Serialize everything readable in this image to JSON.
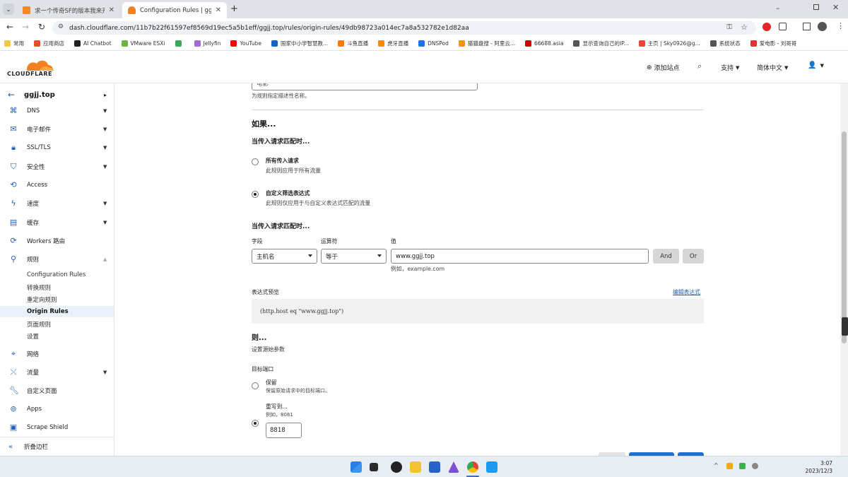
{
  "browser": {
    "tabs": [
      {
        "title": "求一个传奇SF的版本我来开服...",
        "active": false
      },
      {
        "title": "Configuration Rules | ggjj.top",
        "active": true
      }
    ],
    "new_tab": "+",
    "url": "dash.cloudflare.com/11b7b22f61597ef8569d19ec5a5b1eff/ggjj.top/rules/origin-rules/49db98723a014ec7a8a532782e1d82aa",
    "bookmarks": [
      "常用",
      "应用商店",
      "AI Chatbot",
      "VMware ESXi",
      "",
      "Jellyfin",
      "YouTube",
      "国家中小学智慧教...",
      "斗鱼直播",
      "虎牙直播",
      "DNSPod",
      "猫猫盘搜 - 阿里云...",
      "66688.asia",
      "显示查询自己的IP...",
      "主页 | Sky0926@g...",
      "系统状态",
      "爱电影 - 刘哥哥"
    ]
  },
  "header": {
    "logo": "CLOUDFLARE",
    "add_site": "添加站点",
    "support": "支持",
    "language": "简体中文"
  },
  "sidebar": {
    "domain": "ggjj.top",
    "items": [
      {
        "label": "DNS",
        "icon": "network-icon",
        "caret": true
      },
      {
        "label": "电子邮件",
        "icon": "email-icon",
        "caret": true
      },
      {
        "label": "SSL/TLS",
        "icon": "lock-icon",
        "caret": true
      },
      {
        "label": "安全性",
        "icon": "shield-icon",
        "caret": true
      },
      {
        "label": "Access",
        "icon": "access-icon",
        "caret": false
      },
      {
        "label": "速度",
        "icon": "bolt-icon",
        "caret": true
      },
      {
        "label": "缓存",
        "icon": "cache-icon",
        "caret": true
      },
      {
        "label": "Workers 路由",
        "icon": "workers-icon",
        "caret": false
      },
      {
        "label": "规则",
        "icon": "rules-icon",
        "caret": true
      }
    ],
    "subitems": [
      "Configuration Rules",
      "转换规则",
      "重定向规则",
      "Origin Rules",
      "页面规则",
      "设置"
    ],
    "items2": [
      {
        "label": "网络",
        "icon": "pin-icon",
        "caret": false
      },
      {
        "label": "流量",
        "icon": "traffic-icon",
        "caret": true
      },
      {
        "label": "自定义页面",
        "icon": "wrench-icon",
        "caret": false
      },
      {
        "label": "Apps",
        "icon": "apps-icon",
        "caret": false
      },
      {
        "label": "Scrape Shield",
        "icon": "scrape-icon",
        "caret": false
      }
    ],
    "collapse": "折叠边栏"
  },
  "form": {
    "name_value": "电影",
    "name_help": "为规则指定描述性名称。",
    "if_heading": "如果...",
    "match_heading": "当传入请求匹配时...",
    "option_all_title": "所有传入请求",
    "option_all_desc": "此规则应用于所有流量",
    "option_custom_title": "自定义筛选表达式",
    "option_custom_desc": "此规则仅应用于与自定义表达式匹配的流量",
    "match_heading2": "当传入请求匹配时...",
    "field_label": "字段",
    "operator_label": "运算符",
    "value_label": "值",
    "field_value": "主机名",
    "operator_value": "等于",
    "value_value": "www.ggjj.top",
    "value_example": "例如，example.com",
    "and_label": "And",
    "or_label": "Or",
    "preview_label": "表达式预览",
    "edit_expression": "编辑表达式",
    "expression": "(http.host eq \"www.ggjj.top\")",
    "then_heading": "则...",
    "then_sub": "设置源始参数",
    "dest_port_label": "目标端口",
    "keep_title": "保留",
    "keep_desc": "保留原始请求中的目标端口。",
    "rewrite_title": "重写到...",
    "rewrite_example": "例如，8081",
    "port_value": "8818"
  },
  "taskbar": {
    "time": "3:07",
    "date": "2023/12/3"
  }
}
